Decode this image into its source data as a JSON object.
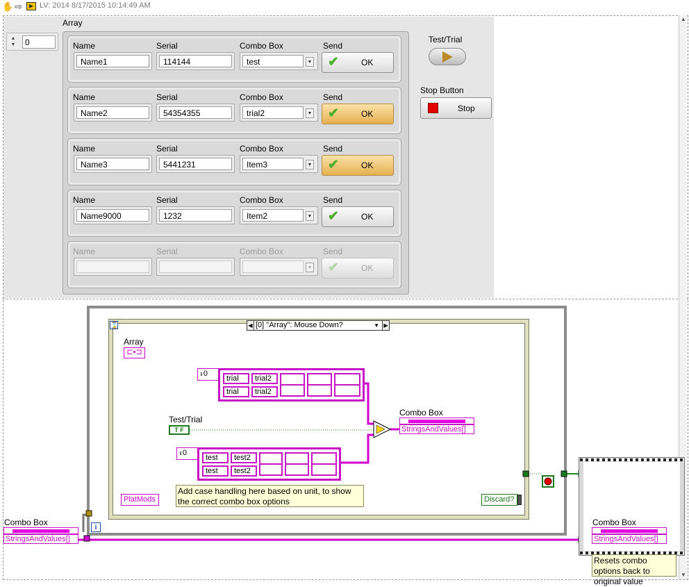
{
  "header": {
    "title": "LV: 2014 8/17/2015 10:14:49 AM"
  },
  "front_panel": {
    "index_value": "0",
    "array_label": "Array",
    "column_labels": {
      "name": "Name",
      "serial": "Serial",
      "combo": "Combo Box",
      "send": "Send"
    },
    "rows": [
      {
        "name": "Name1",
        "serial": "114144",
        "combo": "test",
        "ok": "OK",
        "highlight": false
      },
      {
        "name": "Name2",
        "serial": "54354355",
        "combo": "trial2",
        "ok": "OK",
        "highlight": true
      },
      {
        "name": "Name3",
        "serial": "5441231",
        "combo": "Item3",
        "ok": "OK",
        "highlight": true
      },
      {
        "name": "Name9000",
        "serial": "1232",
        "combo": "Item2",
        "ok": "OK",
        "highlight": false
      },
      {
        "name": "",
        "serial": "",
        "combo": "",
        "ok": "OK",
        "highlight": false
      }
    ],
    "test_trial_label": "Test/Trial",
    "stop_label": "Stop Button",
    "stop_text": "Stop"
  },
  "block_diagram": {
    "case_selector": "[0] \"Array\": Mouse Down?",
    "array_terminal": "Array",
    "const_top": {
      "index": "0",
      "cells": [
        "trial",
        "trial2",
        "trial",
        "trial2"
      ]
    },
    "const_bottom": {
      "index": "0",
      "cells": [
        "test",
        "test2",
        "test",
        "test2"
      ]
    },
    "test_trial_label": "Test/Trial",
    "tf": "T F",
    "combo_label_inner": "Combo Box",
    "combo_prop_inner": "StringsAndValues[]",
    "note_case": "Add case handling here based on unit, to show the correct combo box options",
    "platmods": "PlatMods",
    "discard": "Discard?",
    "combo_label_left": "Combo Box",
    "combo_prop_left": "StringsAndValues[]",
    "combo_label_right": "Combo Box",
    "combo_prop_right": "StringsAndValues[]",
    "note_reset": "Resets combo options back to original value",
    "loop_i": "i"
  }
}
